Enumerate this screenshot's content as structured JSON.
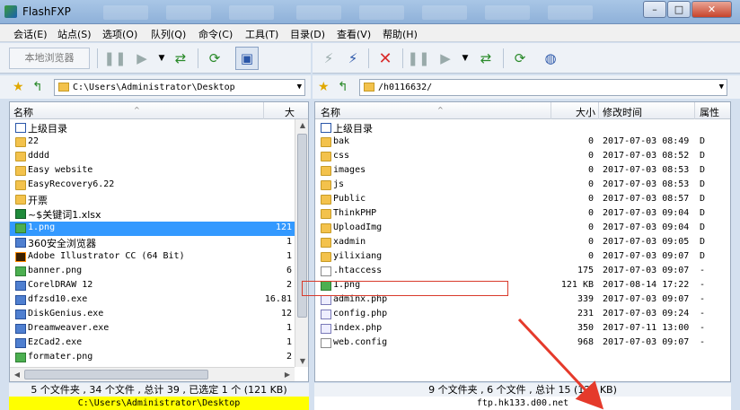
{
  "window": {
    "title": "FlashFXP"
  },
  "menu": [
    "会话(E)",
    "站点(S)",
    "选项(O)",
    "队列(Q)",
    "命令(C)",
    "工具(T)",
    "目录(D)",
    "查看(V)",
    "帮助(H)"
  ],
  "toolbar": {
    "local_browser_label": "本地浏览器"
  },
  "left": {
    "path": "C:\\Users\\Administrator\\Desktop",
    "columns": {
      "name": "名称",
      "size": "大"
    },
    "files": [
      {
        "name": "上级目录",
        "size": "",
        "type": "up"
      },
      {
        "name": "22",
        "size": "",
        "type": "folder"
      },
      {
        "name": "dddd",
        "size": "",
        "type": "folder"
      },
      {
        "name": "Easy website",
        "size": "",
        "type": "folder"
      },
      {
        "name": "EasyRecovery6.22",
        "size": "",
        "type": "folder"
      },
      {
        "name": "开票",
        "size": "",
        "type": "folder"
      },
      {
        "name": "~$关键词1.xlsx",
        "size": "",
        "type": "xlsx"
      },
      {
        "name": "1.png",
        "size": "121",
        "type": "png",
        "selected": true
      },
      {
        "name": "360安全浏览器",
        "size": "1",
        "type": "exe"
      },
      {
        "name": "Adobe Illustrator CC (64 Bit)",
        "size": "1",
        "type": "ai"
      },
      {
        "name": "banner.png",
        "size": "6",
        "type": "png"
      },
      {
        "name": "CorelDRAW 12",
        "size": "2",
        "type": "exe"
      },
      {
        "name": "dfzsd10.exe",
        "size": "16.81",
        "type": "exe"
      },
      {
        "name": "DiskGenius.exe",
        "size": "12",
        "type": "exe"
      },
      {
        "name": "Dreamweaver.exe",
        "size": "1",
        "type": "exe"
      },
      {
        "name": "EzCad2.exe",
        "size": "1",
        "type": "exe"
      },
      {
        "name": "formater.png",
        "size": "2",
        "type": "png"
      }
    ],
    "status": "5 个文件夹 , 34 个文件 , 总计 39 , 已选定 1 个 (121 KB)",
    "path_status": "C:\\Users\\Administrator\\Desktop"
  },
  "right": {
    "path": "/h0116632/",
    "columns": {
      "name": "名称",
      "size": "大小",
      "mtime": "修改时间",
      "attr": "属性"
    },
    "files": [
      {
        "name": "上级目录",
        "size": "",
        "mtime": "",
        "attr": "",
        "type": "up"
      },
      {
        "name": "bak",
        "size": "0",
        "mtime": "2017-07-03 08:49",
        "attr": "D",
        "type": "folder"
      },
      {
        "name": "css",
        "size": "0",
        "mtime": "2017-07-03 08:52",
        "attr": "D",
        "type": "folder"
      },
      {
        "name": "images",
        "size": "0",
        "mtime": "2017-07-03 08:53",
        "attr": "D",
        "type": "folder"
      },
      {
        "name": "js",
        "size": "0",
        "mtime": "2017-07-03 08:53",
        "attr": "D",
        "type": "folder"
      },
      {
        "name": "Public",
        "size": "0",
        "mtime": "2017-07-03 08:57",
        "attr": "D",
        "type": "folder"
      },
      {
        "name": "ThinkPHP",
        "size": "0",
        "mtime": "2017-07-03 09:04",
        "attr": "D",
        "type": "folder"
      },
      {
        "name": "UploadImg",
        "size": "0",
        "mtime": "2017-07-03 09:04",
        "attr": "D",
        "type": "folder"
      },
      {
        "name": "xadmin",
        "size": "0",
        "mtime": "2017-07-03 09:05",
        "attr": "D",
        "type": "folder"
      },
      {
        "name": "yilixiang",
        "size": "0",
        "mtime": "2017-07-03 09:07",
        "attr": "D",
        "type": "folder"
      },
      {
        "name": ".htaccess",
        "size": "175",
        "mtime": "2017-07-03 09:07",
        "attr": "-",
        "type": "file"
      },
      {
        "name": "1.png",
        "size": "121 KB",
        "mtime": "2017-08-14 17:22",
        "attr": "-",
        "type": "png"
      },
      {
        "name": "adminx.php",
        "size": "339",
        "mtime": "2017-07-03 09:07",
        "attr": "-",
        "type": "php"
      },
      {
        "name": "config.php",
        "size": "231",
        "mtime": "2017-07-03 09:24",
        "attr": "-",
        "type": "php"
      },
      {
        "name": "index.php",
        "size": "350",
        "mtime": "2017-07-11 13:00",
        "attr": "-",
        "type": "php"
      },
      {
        "name": "web.config",
        "size": "968",
        "mtime": "2017-07-03 09:07",
        "attr": "-",
        "type": "file"
      }
    ],
    "status": "9 个文件夹 , 6 个文件 , 总计 15 (123 KB)",
    "path_status": "ftp.hk133.d00.net"
  },
  "colors": {
    "selection": "#3399ff",
    "path_status_local": "#ffff00",
    "annotation": "#d93a2b"
  }
}
